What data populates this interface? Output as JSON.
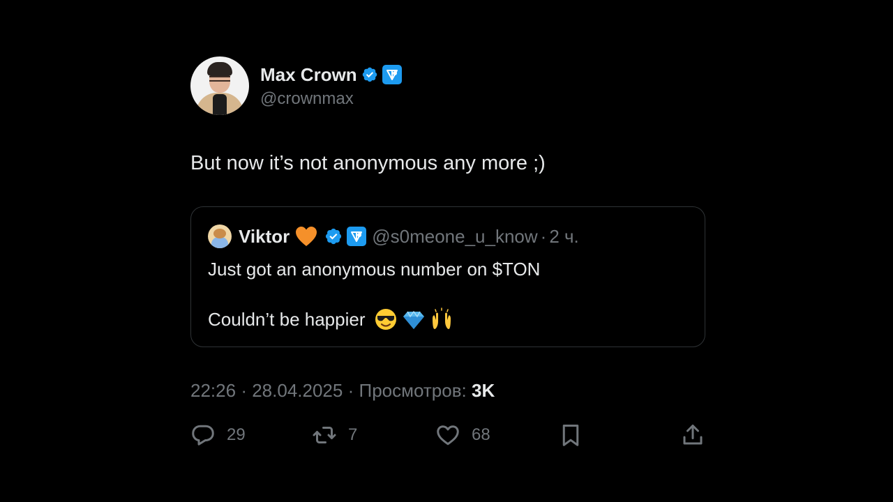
{
  "author": {
    "display_name": "Max Crown",
    "handle": "@crownmax"
  },
  "tweet_text": "But now it’s not anonymous any more ;)",
  "quoted": {
    "display_name": "Viktor",
    "handle": "@s0meone_u_know",
    "separator": "·",
    "time": "2 ч.",
    "line1": "Just got an anonymous number on $TON",
    "line2": "Couldn’t be happier"
  },
  "meta": {
    "time": "22:26",
    "sep1": "·",
    "date": "28.04.2025",
    "sep2": "·",
    "views_label": "Просмотров:",
    "views_count": "3K"
  },
  "actions": {
    "replies": "29",
    "reposts": "7",
    "likes": "68"
  },
  "colors": {
    "background": "#000000",
    "text": "#e7e9ea",
    "secondary": "#71767b",
    "verified_blue": "#1d9bf0",
    "border": "#2f3336"
  }
}
